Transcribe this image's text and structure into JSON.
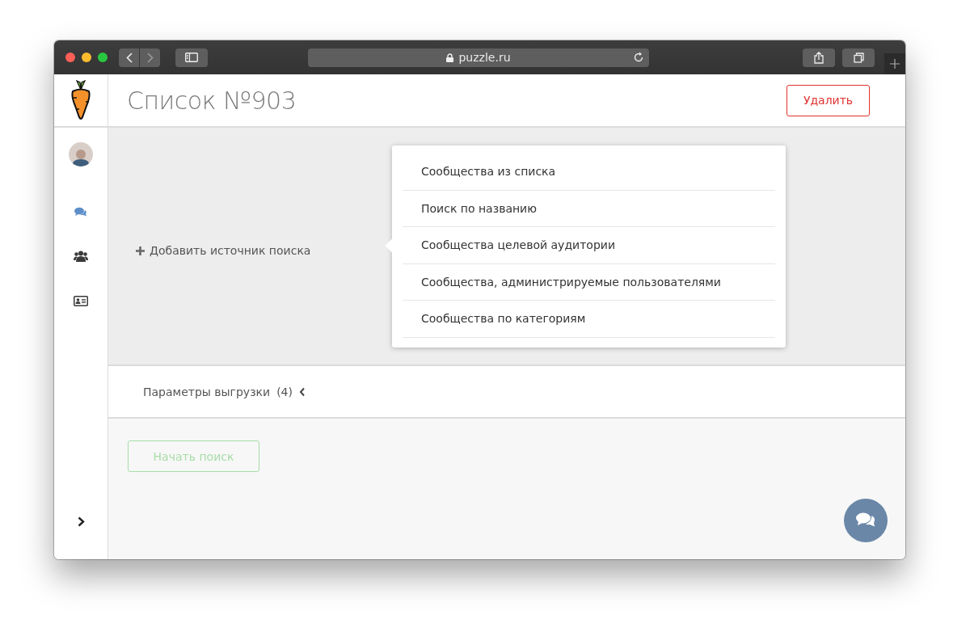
{
  "browser": {
    "address": "puzzle.ru"
  },
  "header": {
    "title": "Список №903",
    "delete_button": "Удалить"
  },
  "sidebar": {
    "items": [
      {
        "kind": "chat",
        "selected": true
      },
      {
        "kind": "group",
        "selected": false
      },
      {
        "kind": "card",
        "selected": false
      }
    ]
  },
  "source": {
    "add_label": "Добавить источник поиска"
  },
  "source_menu": {
    "items": [
      "Сообщества из списка",
      "Поиск по названию",
      "Сообщества целевой аудитории",
      "Сообщества, администрируемые пользователями",
      "Сообщества по категориям"
    ]
  },
  "export_params": {
    "label": "Параметры выгрузки",
    "count": "(4)",
    "expanded": false
  },
  "start_button": {
    "label": "Начать поиск",
    "disabled": true
  }
}
